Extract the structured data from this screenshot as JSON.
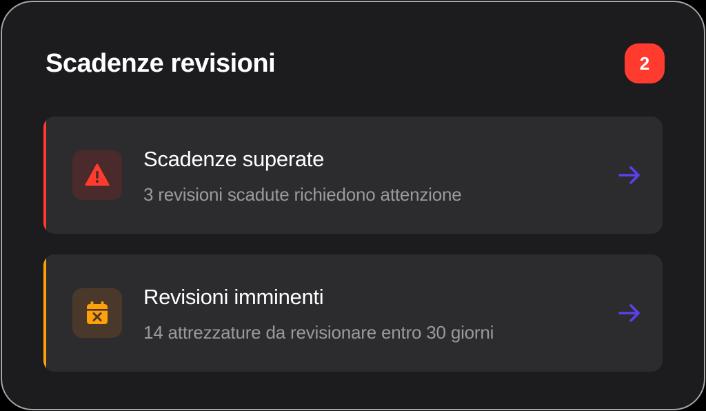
{
  "header": {
    "title": "Scadenze revisioni",
    "badge_count": "2"
  },
  "colors": {
    "background": "#1c1c1e",
    "card": "#2c2c2e",
    "badge": "#ff3b30",
    "overdue_accent": "#ff3b30",
    "upcoming_accent": "#ff9f0a",
    "arrow": "#5e3ff0"
  },
  "alerts": [
    {
      "icon": "warning-triangle-icon",
      "title": "Scadenze superate",
      "subtitle": "3 revisioni scadute richiedono attenzione"
    },
    {
      "icon": "calendar-x-icon",
      "title": "Revisioni imminenti",
      "subtitle": "14 attrezzature da revisionare entro 30 giorni"
    }
  ]
}
